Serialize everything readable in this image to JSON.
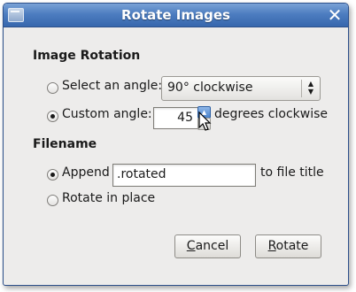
{
  "window": {
    "title": "Rotate Images"
  },
  "rotation": {
    "heading": "Image Rotation",
    "select_label": "Select an angle:",
    "angle_value": "90° clockwise",
    "custom_label": "Custom angle:",
    "custom_value": "45",
    "custom_suffix": "degrees clockwise",
    "selected": "custom"
  },
  "filename": {
    "heading": "Filename",
    "append_label": "Append",
    "append_value": ".rotated",
    "append_suffix": "to file title",
    "inplace_label": "Rotate in place",
    "selected": "append"
  },
  "buttons": {
    "cancel_mnemonic": "C",
    "cancel_rest": "ancel",
    "rotate_mnemonic": "R",
    "rotate_rest": "otate"
  },
  "icons": {
    "app": "window-menu-icon",
    "close": "close-icon",
    "combo": "up-down-arrows-icon",
    "spin_up": "spin-up-arrow-icon",
    "spin_down": "spin-down-arrow-icon",
    "cursor": "mouse-pointer-icon"
  },
  "colors": {
    "titlebar": "#4d7dc0",
    "dialog_bg": "#edeceb",
    "spin_active": "#4a83cc"
  }
}
